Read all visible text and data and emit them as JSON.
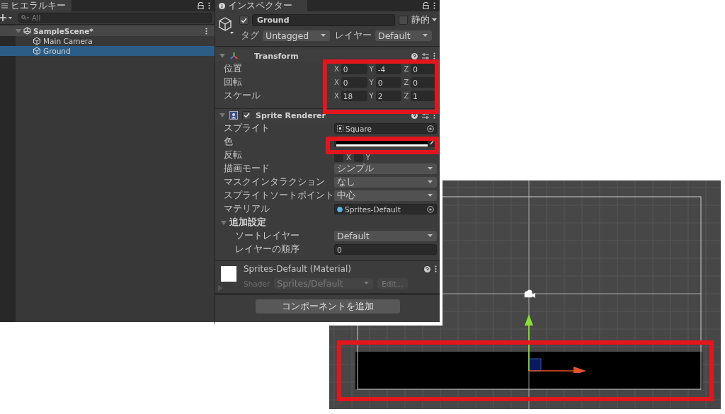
{
  "hierarchy": {
    "tab": "ヒエラルキー",
    "search": {
      "placeholder": "All"
    },
    "scene": {
      "name": "SampleScene*",
      "expanded": true
    },
    "items": [
      {
        "name": "Main Camera",
        "selected": false
      },
      {
        "name": "Ground",
        "selected": true
      }
    ]
  },
  "inspector": {
    "tab": "インスペクター",
    "object": {
      "active": true,
      "name": "Ground",
      "static": false,
      "static_label": "静的",
      "tag_label": "タグ",
      "tag": "Untagged",
      "layer_label": "レイヤー",
      "layer": "Default"
    },
    "transform": {
      "title": "Transform",
      "expanded": true,
      "rows": [
        {
          "label": "位置",
          "values": [
            {
              "axis": "X",
              "value": "0"
            },
            {
              "axis": "Y",
              "value": "-4"
            },
            {
              "axis": "Z",
              "value": "0"
            }
          ]
        },
        {
          "label": "回転",
          "values": [
            {
              "axis": "X",
              "value": "0"
            },
            {
              "axis": "Y",
              "value": "0"
            },
            {
              "axis": "Z",
              "value": "0"
            }
          ]
        },
        {
          "label": "スケール",
          "values": [
            {
              "axis": "X",
              "value": "18"
            },
            {
              "axis": "Y",
              "value": "2"
            },
            {
              "axis": "Z",
              "value": "1"
            }
          ]
        }
      ]
    },
    "sprite_renderer": {
      "title": "Sprite Renderer",
      "enabled": true,
      "expanded": true,
      "fields": [
        {
          "kind": "object",
          "label": "スプライト",
          "value": "Square"
        },
        {
          "kind": "color",
          "label": "色",
          "color": "#000000"
        },
        {
          "kind": "flip",
          "label": "反転",
          "axes": [
            {
              "axis": "X",
              "checked": false
            },
            {
              "axis": "Y",
              "checked": false
            }
          ]
        },
        {
          "kind": "dropdown",
          "label": "描画モード",
          "value": "シンプル"
        },
        {
          "kind": "dropdown",
          "label": "マスクインタラクション",
          "value": "なし"
        },
        {
          "kind": "dropdown",
          "label": "スプライトソートポイント",
          "value": "中心"
        },
        {
          "kind": "material",
          "label": "マテリアル",
          "value": "Sprites-Default"
        }
      ],
      "additional": {
        "title": "追加設定",
        "expanded": true,
        "fields": [
          {
            "kind": "dropdown",
            "label": "ソートレイヤー",
            "value": "Default"
          },
          {
            "kind": "text",
            "label": "レイヤーの順序",
            "value": "0"
          }
        ]
      }
    },
    "material": {
      "title": "Sprites-Default (Material)",
      "expanded": false,
      "shader_label": "Shader",
      "shader": "Sprites/Default",
      "edit_button": "Edit..."
    },
    "add_component_button": "コンポーネントを追加"
  }
}
